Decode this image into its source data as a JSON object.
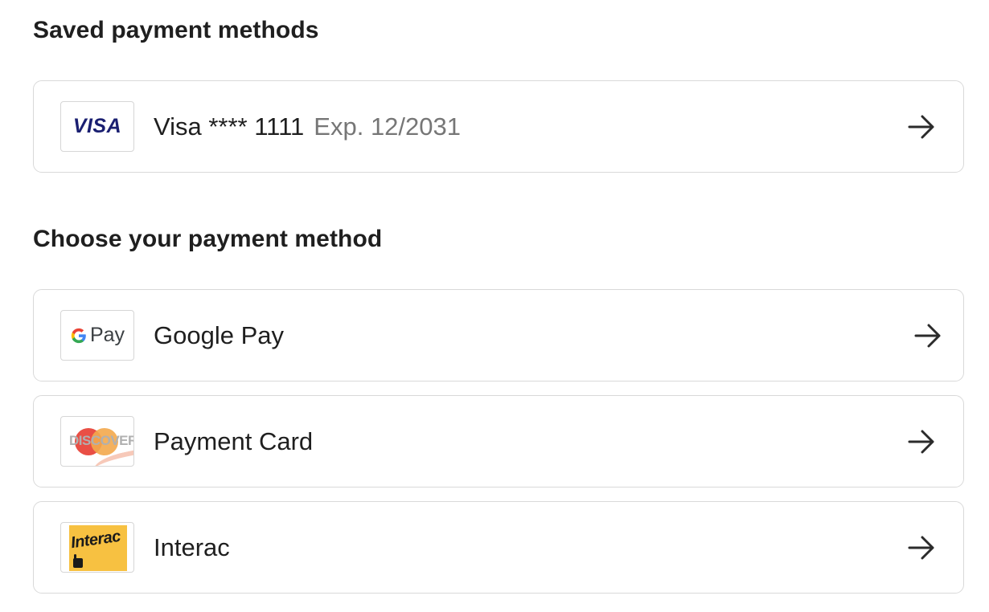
{
  "saved_section": {
    "title": "Saved payment methods",
    "items": [
      {
        "logo": "visa-logo",
        "logo_text": "VISA",
        "label": "Visa **** 1111",
        "sublabel": "Exp. 12/2031",
        "arrow_icon": "arrow-right-icon"
      }
    ]
  },
  "choose_section": {
    "title": "Choose your payment method",
    "items": [
      {
        "logo": "google-pay-logo",
        "logo_text": "Pay",
        "label": "Google Pay",
        "arrow_icon": "arrow-right-icon"
      },
      {
        "logo": "discover-mastercard-logo",
        "logo_text": "DISCOVER",
        "label": "Payment Card",
        "arrow_icon": "arrow-right-icon"
      },
      {
        "logo": "interac-logo",
        "logo_text": "Interac",
        "label": "Interac",
        "arrow_icon": "arrow-right-icon"
      }
    ]
  },
  "colors": {
    "visa_blue": "#1a1f71",
    "interac_yellow": "#f7c141",
    "mastercard_red": "#e8463b",
    "mastercard_orange": "#f3a94c",
    "border": "#d9d9d9",
    "muted_text": "#767676"
  }
}
